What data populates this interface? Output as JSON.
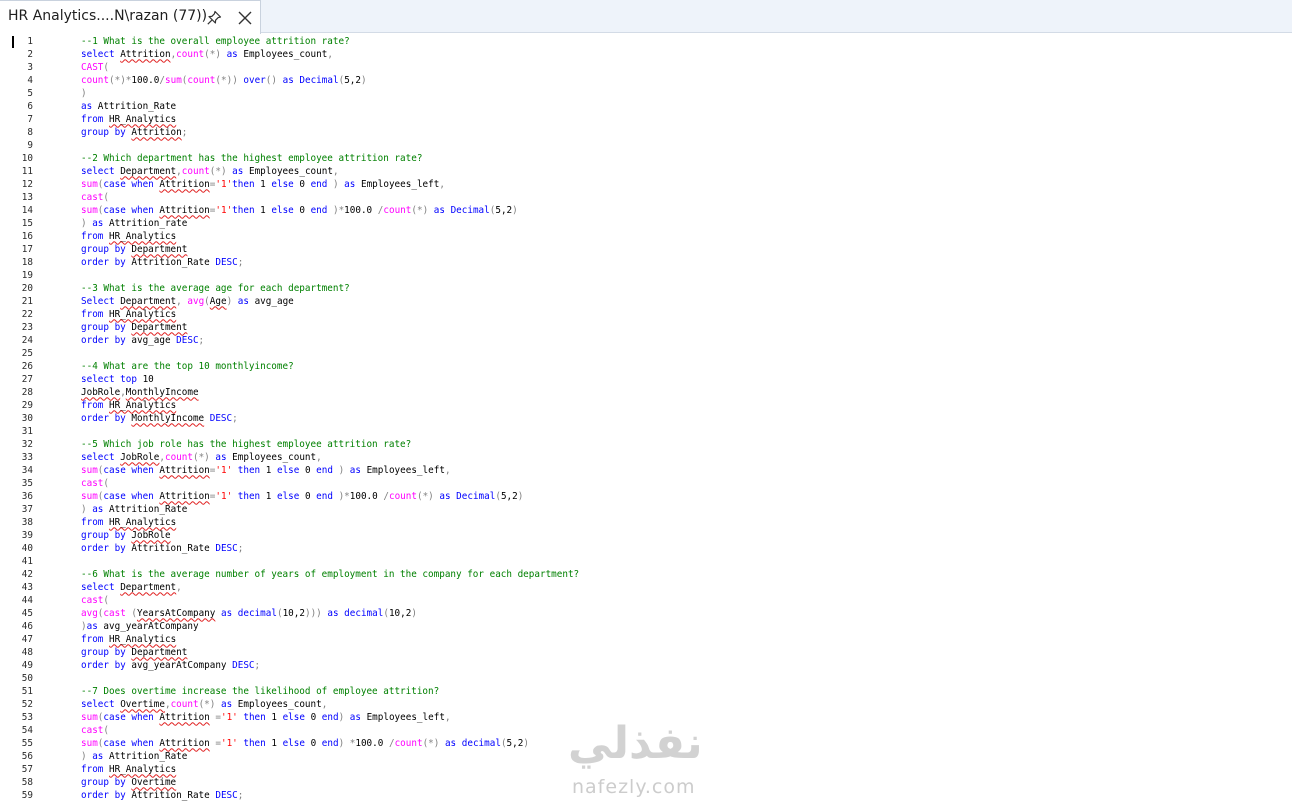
{
  "tab": {
    "title": "HR Analytics....N\\razan (77))",
    "pin_icon": "pin-icon",
    "close_icon": "close-icon"
  },
  "colors": {
    "keyword": "#0000ff",
    "function": "#ff00ff",
    "string": "#ff0000",
    "comment": "#008000",
    "operator": "#808080",
    "text": "#000000"
  },
  "watermark": {
    "arabic": "نفذلي",
    "latin": "nafezly.com"
  },
  "editor": {
    "lines": [
      [
        [
          "cm",
          "--1 What is the overall employee attrition rate?"
        ]
      ],
      [
        [
          "kw",
          "select "
        ],
        [
          "sq",
          "Attrition"
        ],
        [
          "op",
          ","
        ],
        [
          "fn",
          "count"
        ],
        [
          "op",
          "(*)"
        ],
        [
          "kw",
          " as "
        ],
        [
          "tx",
          "Employees_count"
        ],
        [
          "op",
          ","
        ]
      ],
      [
        [
          "fn",
          "CAST"
        ],
        [
          "op",
          "("
        ]
      ],
      [
        [
          "fn",
          "count"
        ],
        [
          "op",
          "(*)*"
        ],
        [
          "tx",
          "100.0"
        ],
        [
          "op",
          "/"
        ],
        [
          "fn",
          "sum"
        ],
        [
          "op",
          "("
        ],
        [
          "fn",
          "count"
        ],
        [
          "op",
          "(*))"
        ],
        [
          "kw",
          " over"
        ],
        [
          "op",
          "()"
        ],
        [
          "kw",
          " as "
        ],
        [
          "kw",
          "Decimal"
        ],
        [
          "op",
          "("
        ],
        [
          "tx",
          "5,2"
        ],
        [
          "op",
          ")"
        ]
      ],
      [
        [
          "op",
          ")"
        ]
      ],
      [
        [
          "kw",
          "as "
        ],
        [
          "tx",
          "Attrition_Rate"
        ]
      ],
      [
        [
          "kw",
          "from "
        ],
        [
          "sq",
          "HR_Analytics"
        ]
      ],
      [
        [
          "kw",
          "group by "
        ],
        [
          "sq",
          "Attrition"
        ],
        [
          "op",
          ";"
        ]
      ],
      [],
      [
        [
          "cm",
          "--2 Which department has the highest employee attrition rate?"
        ]
      ],
      [
        [
          "kw",
          "select "
        ],
        [
          "sq",
          "Department"
        ],
        [
          "op",
          ","
        ],
        [
          "fn",
          "count"
        ],
        [
          "op",
          "(*)"
        ],
        [
          "kw",
          " as "
        ],
        [
          "tx",
          "Employees_count"
        ],
        [
          "op",
          ","
        ]
      ],
      [
        [
          "fn",
          "sum"
        ],
        [
          "op",
          "("
        ],
        [
          "kw",
          "case when "
        ],
        [
          "sq",
          "Attrition"
        ],
        [
          "op",
          "="
        ],
        [
          "str",
          "'1'"
        ],
        [
          "kw",
          "then "
        ],
        [
          "tx",
          "1 "
        ],
        [
          "kw",
          "else "
        ],
        [
          "tx",
          "0 "
        ],
        [
          "kw",
          "end "
        ],
        [
          "op",
          ")"
        ],
        [
          "kw",
          " as "
        ],
        [
          "tx",
          "Employees_left"
        ],
        [
          "op",
          ","
        ]
      ],
      [
        [
          "fn",
          "cast"
        ],
        [
          "op",
          "("
        ]
      ],
      [
        [
          "fn",
          "sum"
        ],
        [
          "op",
          "("
        ],
        [
          "kw",
          "case when "
        ],
        [
          "sq",
          "Attrition"
        ],
        [
          "op",
          "="
        ],
        [
          "str",
          "'1'"
        ],
        [
          "kw",
          "then "
        ],
        [
          "tx",
          "1 "
        ],
        [
          "kw",
          "else "
        ],
        [
          "tx",
          "0 "
        ],
        [
          "kw",
          "end "
        ],
        [
          "op",
          ")*"
        ],
        [
          "tx",
          "100.0 "
        ],
        [
          "op",
          "/"
        ],
        [
          "fn",
          "count"
        ],
        [
          "op",
          "(*)"
        ],
        [
          "kw",
          " as "
        ],
        [
          "kw",
          "Decimal"
        ],
        [
          "op",
          "("
        ],
        [
          "tx",
          "5,2"
        ],
        [
          "op",
          ")"
        ]
      ],
      [
        [
          "op",
          ") "
        ],
        [
          "kw",
          "as "
        ],
        [
          "tx",
          "Attrition_rate"
        ]
      ],
      [
        [
          "kw",
          "from "
        ],
        [
          "sq",
          "HR_Analytics"
        ]
      ],
      [
        [
          "kw",
          "group by "
        ],
        [
          "sq",
          "Department"
        ]
      ],
      [
        [
          "kw",
          "order by "
        ],
        [
          "tx",
          "Attrition_Rate "
        ],
        [
          "kw",
          "DESC"
        ],
        [
          "op",
          ";"
        ]
      ],
      [],
      [
        [
          "cm",
          "--3 What is the average age for each department?"
        ]
      ],
      [
        [
          "kw",
          "Select "
        ],
        [
          "sq",
          "Department"
        ],
        [
          "op",
          ", "
        ],
        [
          "fn",
          "avg"
        ],
        [
          "op",
          "("
        ],
        [
          "sq",
          "Age"
        ],
        [
          "op",
          ")"
        ],
        [
          "kw",
          " as "
        ],
        [
          "tx",
          "avg_age"
        ]
      ],
      [
        [
          "kw",
          "from "
        ],
        [
          "sq",
          "HR_Analytics"
        ]
      ],
      [
        [
          "kw",
          "group by "
        ],
        [
          "sq",
          "Department"
        ]
      ],
      [
        [
          "kw",
          "order by "
        ],
        [
          "tx",
          "avg_age "
        ],
        [
          "kw",
          "DESC"
        ],
        [
          "op",
          ";"
        ]
      ],
      [],
      [
        [
          "cm",
          "--4 What are the top 10 monthlyincome?"
        ]
      ],
      [
        [
          "kw",
          "select top "
        ],
        [
          "tx",
          "10"
        ]
      ],
      [
        [
          "sq",
          "JobRole"
        ],
        [
          "op",
          ","
        ],
        [
          "sq",
          "MonthlyIncome"
        ]
      ],
      [
        [
          "kw",
          "from "
        ],
        [
          "sq",
          "HR_Analytics"
        ]
      ],
      [
        [
          "kw",
          "order by "
        ],
        [
          "sq",
          "MonthlyIncome"
        ],
        [
          "kw",
          " DESC"
        ],
        [
          "op",
          ";"
        ]
      ],
      [],
      [
        [
          "cm",
          "--5 Which job role has the highest employee attrition rate?"
        ]
      ],
      [
        [
          "kw",
          "select "
        ],
        [
          "sq",
          "JobRole"
        ],
        [
          "op",
          ","
        ],
        [
          "fn",
          "count"
        ],
        [
          "op",
          "(*)"
        ],
        [
          "kw",
          " as "
        ],
        [
          "tx",
          "Employees_count"
        ],
        [
          "op",
          ","
        ]
      ],
      [
        [
          "fn",
          "sum"
        ],
        [
          "op",
          "("
        ],
        [
          "kw",
          "case when "
        ],
        [
          "sq",
          "Attrition"
        ],
        [
          "op",
          "="
        ],
        [
          "str",
          "'1'"
        ],
        [
          "kw",
          " then "
        ],
        [
          "tx",
          "1 "
        ],
        [
          "kw",
          "else "
        ],
        [
          "tx",
          "0 "
        ],
        [
          "kw",
          "end "
        ],
        [
          "op",
          ")"
        ],
        [
          "kw",
          " as "
        ],
        [
          "tx",
          "Employees_left"
        ],
        [
          "op",
          ","
        ]
      ],
      [
        [
          "fn",
          "cast"
        ],
        [
          "op",
          "("
        ]
      ],
      [
        [
          "fn",
          "sum"
        ],
        [
          "op",
          "("
        ],
        [
          "kw",
          "case when "
        ],
        [
          "sq",
          "Attrition"
        ],
        [
          "op",
          "="
        ],
        [
          "str",
          "'1'"
        ],
        [
          "kw",
          " then "
        ],
        [
          "tx",
          "1 "
        ],
        [
          "kw",
          "else "
        ],
        [
          "tx",
          "0 "
        ],
        [
          "kw",
          "end "
        ],
        [
          "op",
          ")*"
        ],
        [
          "tx",
          "100.0 "
        ],
        [
          "op",
          "/"
        ],
        [
          "fn",
          "count"
        ],
        [
          "op",
          "(*)"
        ],
        [
          "kw",
          " as "
        ],
        [
          "kw",
          "Decimal"
        ],
        [
          "op",
          "("
        ],
        [
          "tx",
          "5,2"
        ],
        [
          "op",
          ")"
        ]
      ],
      [
        [
          "op",
          ") "
        ],
        [
          "kw",
          "as "
        ],
        [
          "tx",
          "Attrition_Rate"
        ]
      ],
      [
        [
          "kw",
          "from "
        ],
        [
          "sq",
          "HR_Analytics"
        ]
      ],
      [
        [
          "kw",
          "group by "
        ],
        [
          "sq",
          "JobRole"
        ]
      ],
      [
        [
          "kw",
          "order by "
        ],
        [
          "tx",
          "Attrition_Rate "
        ],
        [
          "kw",
          "DESC"
        ],
        [
          "op",
          ";"
        ]
      ],
      [],
      [
        [
          "cm",
          "--6 What is the average number of years of employment in the company for each department?"
        ]
      ],
      [
        [
          "kw",
          "select "
        ],
        [
          "sq",
          "Department"
        ],
        [
          "op",
          ","
        ]
      ],
      [
        [
          "fn",
          "cast"
        ],
        [
          "op",
          "("
        ]
      ],
      [
        [
          "fn",
          "avg"
        ],
        [
          "op",
          "("
        ],
        [
          "fn",
          "cast "
        ],
        [
          "op",
          "("
        ],
        [
          "sq",
          "YearsAtCompany"
        ],
        [
          "kw",
          " as "
        ],
        [
          "kw",
          "decimal"
        ],
        [
          "op",
          "("
        ],
        [
          "tx",
          "10,2"
        ],
        [
          "op",
          ")))"
        ],
        [
          "kw",
          " as "
        ],
        [
          "kw",
          "decimal"
        ],
        [
          "op",
          "("
        ],
        [
          "tx",
          "10,2"
        ],
        [
          "op",
          ")"
        ]
      ],
      [
        [
          "op",
          ")"
        ],
        [
          "kw",
          "as "
        ],
        [
          "tx",
          "avg_yearAtCompany"
        ]
      ],
      [
        [
          "kw",
          "from "
        ],
        [
          "sq",
          "HR_Analytics"
        ]
      ],
      [
        [
          "kw",
          "group by "
        ],
        [
          "sq",
          "Department"
        ]
      ],
      [
        [
          "kw",
          "order by "
        ],
        [
          "tx",
          "avg_yearAtCompany "
        ],
        [
          "kw",
          "DESC"
        ],
        [
          "op",
          ";"
        ]
      ],
      [],
      [
        [
          "cm",
          "--7 Does overtime increase the likelihood of employee attrition?"
        ]
      ],
      [
        [
          "kw",
          "select "
        ],
        [
          "sq",
          "Overtime"
        ],
        [
          "op",
          ","
        ],
        [
          "fn",
          "count"
        ],
        [
          "op",
          "(*)"
        ],
        [
          "kw",
          " as "
        ],
        [
          "tx",
          "Employees_count"
        ],
        [
          "op",
          ","
        ]
      ],
      [
        [
          "fn",
          "sum"
        ],
        [
          "op",
          "("
        ],
        [
          "kw",
          "case when "
        ],
        [
          "sq",
          "Attrition"
        ],
        [
          "op",
          " ="
        ],
        [
          "str",
          "'1'"
        ],
        [
          "kw",
          " then "
        ],
        [
          "tx",
          "1 "
        ],
        [
          "kw",
          "else "
        ],
        [
          "tx",
          "0 "
        ],
        [
          "kw",
          "end"
        ],
        [
          "op",
          ")"
        ],
        [
          "kw",
          " as "
        ],
        [
          "tx",
          "Employees_left"
        ],
        [
          "op",
          ","
        ]
      ],
      [
        [
          "fn",
          "cast"
        ],
        [
          "op",
          "("
        ]
      ],
      [
        [
          "fn",
          "sum"
        ],
        [
          "op",
          "("
        ],
        [
          "kw",
          "case when "
        ],
        [
          "sq",
          "Attrition"
        ],
        [
          "op",
          " ="
        ],
        [
          "str",
          "'1'"
        ],
        [
          "kw",
          " then "
        ],
        [
          "tx",
          "1 "
        ],
        [
          "kw",
          "else "
        ],
        [
          "tx",
          "0 "
        ],
        [
          "kw",
          "end"
        ],
        [
          "op",
          ") *"
        ],
        [
          "tx",
          "100.0 "
        ],
        [
          "op",
          "/"
        ],
        [
          "fn",
          "count"
        ],
        [
          "op",
          "(*)"
        ],
        [
          "kw",
          " as "
        ],
        [
          "kw",
          "decimal"
        ],
        [
          "op",
          "("
        ],
        [
          "tx",
          "5,2"
        ],
        [
          "op",
          ")"
        ]
      ],
      [
        [
          "op",
          ") "
        ],
        [
          "kw",
          "as "
        ],
        [
          "tx",
          "Attrition_Rate"
        ]
      ],
      [
        [
          "kw",
          "from "
        ],
        [
          "sq",
          "HR_Analytics"
        ]
      ],
      [
        [
          "kw",
          "group by "
        ],
        [
          "sq",
          "Overtime"
        ]
      ],
      [
        [
          "kw",
          "order by "
        ],
        [
          "tx",
          "Attrition_Rate "
        ],
        [
          "kw",
          "DESC"
        ],
        [
          "op",
          ";"
        ]
      ]
    ]
  }
}
